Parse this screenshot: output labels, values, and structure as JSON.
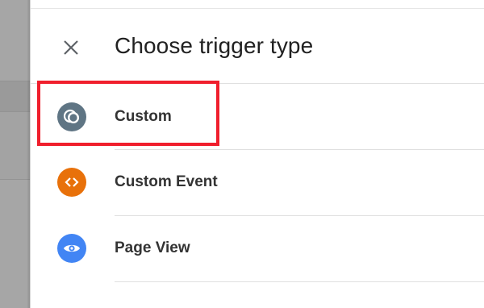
{
  "dialog": {
    "title": "Choose trigger type",
    "close_icon": "close-icon"
  },
  "trigger_types": [
    {
      "label": "Custom",
      "icon": "custom-trigger-icon",
      "color": "#5f7584"
    },
    {
      "label": "Custom Event",
      "icon": "code-brackets-icon",
      "color": "#e8710a"
    },
    {
      "label": "Page View",
      "icon": "eye-icon",
      "color": "#4285f4"
    }
  ],
  "annotation": {
    "highlight_color": "#f01f2d"
  }
}
